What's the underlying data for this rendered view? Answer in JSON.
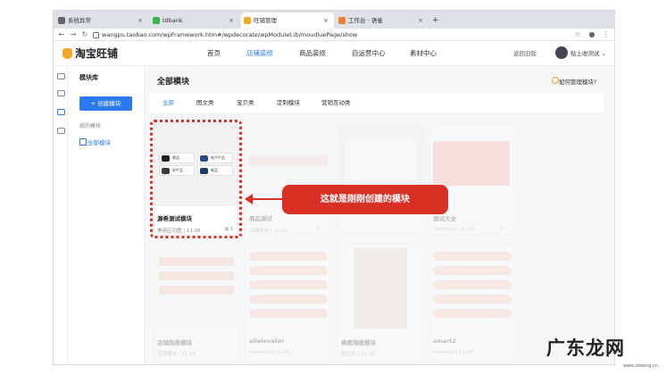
{
  "browser": {
    "tabs": [
      {
        "label": "系统异常",
        "active": false
      },
      {
        "label": "tdbank",
        "active": false
      },
      {
        "label": "旺铺管理",
        "active": true
      },
      {
        "label": "工作台 · 语雀",
        "active": false
      }
    ],
    "new_tab": "+",
    "url": "wangpu.taobao.com/wpFramework.htm#/wpdecorate/wpModulet.ib/moudluePage/show"
  },
  "header": {
    "logo": "淘宝旺铺",
    "nav": [
      "首页",
      "店铺装修",
      "商品装修",
      "自运营中心",
      "素材中心"
    ],
    "active_nav": "店铺装修",
    "old_version": "返回旧版",
    "username": "贴上收测试"
  },
  "sidebar": {
    "title": "模块库",
    "create_button": "+ 创建模块",
    "my_modules": "我的模块",
    "all_modules": "全部模块"
  },
  "main": {
    "title": "全部模块",
    "help": "如何管理模块?",
    "filters": [
      "全部",
      "图文类",
      "宝贝类",
      "定制模块",
      "营销互动类"
    ],
    "active_filter": "全部",
    "cards": [
      {
        "name": "源希测试模块",
        "meta": "美容区功图 | 11.06",
        "count": "1",
        "thumb_items": [
          "商品",
          "电子产品",
          "好产品",
          "新品"
        ]
      },
      {
        "name": "商品测试",
        "meta": "店铺模块 | 11.06",
        "count": "1"
      },
      {
        "name": "",
        "meta": "",
        "count": ""
      },
      {
        "name": "测试大全",
        "meta": "common | 11.06",
        "count": "0"
      },
      {
        "name": "",
        "meta": "",
        "count": ""
      },
      {
        "name": "",
        "meta": "",
        "count": ""
      },
      {
        "name": "",
        "meta": "",
        "count": ""
      },
      {
        "name": "",
        "meta": "",
        "count": ""
      },
      {
        "name": "店铺热搜模块",
        "meta": "营销模块 | 11.06",
        "count": "0"
      },
      {
        "name": "allelevator",
        "meta": "common | 11.06",
        "count": "0"
      },
      {
        "name": "美图海报模块",
        "meta": "图文类 | 11.06",
        "count": "0"
      },
      {
        "name": "smart2",
        "meta": "common | 11.06",
        "count": "0"
      }
    ]
  },
  "annotation": {
    "callout": "这就是刚刚创建的模块"
  },
  "watermark": {
    "text": "广东龙网",
    "sub": "www.ldwang.cn"
  },
  "colors": {
    "accent": "#2b7af0",
    "highlight": "#d93025",
    "logo": "#f5a623"
  }
}
